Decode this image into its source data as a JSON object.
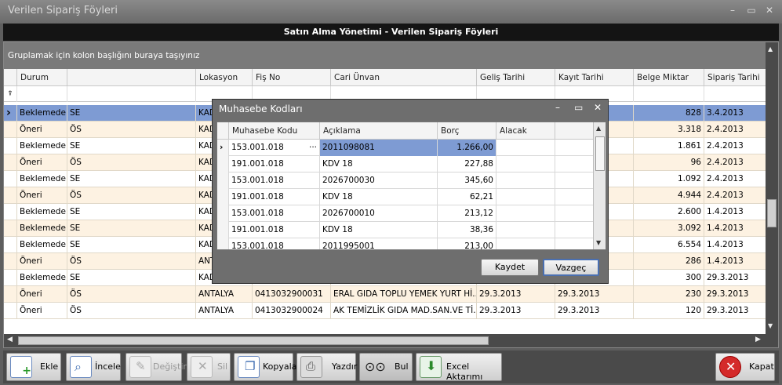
{
  "window": {
    "title": "Verilen Sipariş Föyleri"
  },
  "header": {
    "title": "Satın Alma Yönetimi - Verilen Sipariş Föyleri"
  },
  "grid": {
    "group_hint": "Gruplamak için kolon başlığını buraya taşıyınız",
    "columns": [
      "Durum",
      "",
      "Lokasyon",
      "Fiş No",
      "Cari Ünvan",
      "Geliş Tarihi",
      "Kayıt Tarihi",
      "Belge Miktar",
      "Sipariş Tarihi"
    ],
    "rows": [
      [
        "Beklemede",
        "SE",
        "KAD",
        "",
        "",
        "",
        "",
        "828",
        "3.4.2013"
      ],
      [
        "Öneri",
        "ÖS",
        "KAD",
        "",
        "",
        "",
        "",
        "3.318",
        "2.4.2013"
      ],
      [
        "Beklemede",
        "SE",
        "KAD",
        "",
        "",
        "",
        "",
        "1.861",
        "2.4.2013"
      ],
      [
        "Öneri",
        "ÖS",
        "KAD",
        "",
        "",
        "",
        "",
        "96",
        "2.4.2013"
      ],
      [
        "Beklemede",
        "SE",
        "KAD",
        "",
        "",
        "",
        "",
        "1.092",
        "2.4.2013"
      ],
      [
        "Öneri",
        "ÖS",
        "KAD",
        "",
        "",
        "",
        "",
        "4.944",
        "2.4.2013"
      ],
      [
        "Beklemede",
        "SE",
        "KAD",
        "",
        "",
        "",
        "",
        "2.600",
        "1.4.2013"
      ],
      [
        "Beklemede",
        "SE",
        "KAD",
        "",
        "",
        "",
        "",
        "3.092",
        "1.4.2013"
      ],
      [
        "Beklemede",
        "SE",
        "KAD",
        "",
        "",
        "",
        "",
        "6.554",
        "1.4.2013"
      ],
      [
        "Öneri",
        "ÖS",
        "ANT",
        "",
        "",
        "",
        "",
        "286",
        "1.4.2013"
      ],
      [
        "Beklemede",
        "SE",
        "KAD",
        "",
        "",
        "",
        "",
        "300",
        "29.3.2013"
      ],
      [
        "Öneri",
        "ÖS",
        "ANTALYA",
        "0413032900031",
        "ERAL GIDA TOPLU YEMEK YURT Hİ...",
        "29.3.2013",
        "29.3.2013",
        "230",
        "29.3.2013"
      ],
      [
        "Öneri",
        "ÖS",
        "ANTALYA",
        "0413032900024",
        "AK TEMİZLİK GIDA MAD.SAN.VE Tİ...",
        "29.3.2013",
        "29.3.2013",
        "120",
        "29.3.2013"
      ]
    ]
  },
  "dialog": {
    "title": "Muhasebe Kodları",
    "columns": [
      "Muhasebe Kodu",
      "Açıklama",
      "Borç",
      "Alacak"
    ],
    "rows": [
      [
        "153.001.018",
        "2011098081",
        "1.266,00",
        ""
      ],
      [
        "191.001.018",
        "KDV 18",
        "227,88",
        ""
      ],
      [
        "153.001.018",
        "2026700030",
        "345,60",
        ""
      ],
      [
        "191.001.018",
        "KDV 18",
        "62,21",
        ""
      ],
      [
        "153.001.018",
        "2026700010",
        "213,12",
        ""
      ],
      [
        "191.001.018",
        "KDV 18",
        "38,36",
        ""
      ],
      [
        "153.001.018",
        "2011995001",
        "213,00",
        ""
      ]
    ],
    "save_label": "Kaydet",
    "cancel_label": "Vazgeç",
    "ellipsis": "···"
  },
  "toolbar": {
    "add": "Ekle",
    "inspect": "İncele",
    "edit": "Değiştir",
    "delete": "Sil",
    "copy": "Kopyala",
    "print": "Yazdır",
    "find": "Bul",
    "excel": "Excel Aktarımı",
    "close": "Kapat"
  },
  "icons": {
    "selected_row": "chevron-right",
    "filter": "funnel"
  }
}
